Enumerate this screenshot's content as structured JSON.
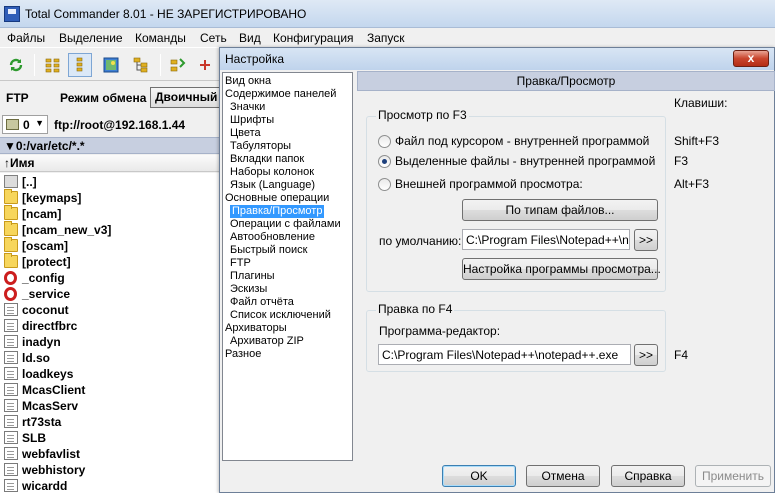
{
  "app": {
    "title": "Total Commander 8.01 - НЕ ЗАРЕГИСТРИРОВАНО"
  },
  "menu": [
    "Файлы",
    "Выделение",
    "Команды",
    "Сеть",
    "Вид",
    "Конфигурация",
    "Запуск"
  ],
  "toolbar": {
    "icons": [
      "refresh-icon",
      "brief-view-icon",
      "detailed-view-icon",
      "thumbnail-view-icon",
      "tree-view-icon",
      "invert-selection-icon"
    ]
  },
  "ftp_bar": {
    "label": "FTP",
    "mode_label": "Режим обмена",
    "mode_value": "Двоичный"
  },
  "drive_bar": {
    "drive": "0",
    "path": "ftp://root@192.168.1.44"
  },
  "panel": {
    "current_path": "▼0:/var/etc/*.*",
    "column_name": "↑Имя",
    "files": [
      {
        "name": "[..]",
        "type": "updir"
      },
      {
        "name": "[keymaps]",
        "type": "folder"
      },
      {
        "name": "[ncam]",
        "type": "folder"
      },
      {
        "name": "[ncam_new_v3]",
        "type": "folder"
      },
      {
        "name": "[oscam]",
        "type": "folder"
      },
      {
        "name": "[protect]",
        "type": "folder"
      },
      {
        "name": "_config",
        "type": "opera"
      },
      {
        "name": "_service",
        "type": "opera"
      },
      {
        "name": "coconut",
        "type": "file"
      },
      {
        "name": "directfbrc",
        "type": "file"
      },
      {
        "name": "inadyn",
        "type": "file"
      },
      {
        "name": "ld.so",
        "type": "file"
      },
      {
        "name": "loadkeys",
        "type": "file"
      },
      {
        "name": "McasClient",
        "type": "file"
      },
      {
        "name": "McasServ",
        "type": "file"
      },
      {
        "name": "rt73sta",
        "type": "file"
      },
      {
        "name": "SLB",
        "type": "file"
      },
      {
        "name": "webfavlist",
        "type": "file"
      },
      {
        "name": "webhistory",
        "type": "file"
      },
      {
        "name": "wicardd",
        "type": "file"
      }
    ]
  },
  "dialog": {
    "title": "Настройка",
    "close_label": "x",
    "tree": [
      {
        "label": "Вид окна",
        "level": 0
      },
      {
        "label": "Содержимое панелей",
        "level": 0
      },
      {
        "label": "Значки",
        "level": 1
      },
      {
        "label": "Шрифты",
        "level": 1
      },
      {
        "label": "Цвета",
        "level": 1
      },
      {
        "label": "Табуляторы",
        "level": 1
      },
      {
        "label": "Вкладки папок",
        "level": 1
      },
      {
        "label": "Наборы колонок",
        "level": 1
      },
      {
        "label": "Язык (Language)",
        "level": 1
      },
      {
        "label": "Основные операции",
        "level": 0
      },
      {
        "label": "Правка/Просмотр",
        "level": 1,
        "selected": true
      },
      {
        "label": "Операции с файлами",
        "level": 1
      },
      {
        "label": "Автообновление",
        "level": 1
      },
      {
        "label": "Быстрый поиск",
        "level": 1
      },
      {
        "label": "FTP",
        "level": 1
      },
      {
        "label": "Плагины",
        "level": 1
      },
      {
        "label": "Эскизы",
        "level": 1
      },
      {
        "label": "Файл отчёта",
        "level": 1
      },
      {
        "label": "Список исключений",
        "level": 1
      },
      {
        "label": "Архиваторы",
        "level": 0
      },
      {
        "label": "Архиватор ZIP",
        "level": 1
      },
      {
        "label": "Разное",
        "level": 0
      }
    ],
    "pane_title": "Правка/Просмотр",
    "keys_label": "Клавиши:",
    "view_group": {
      "title": "Просмотр по F3",
      "options": [
        {
          "label": "Файл под курсором - внутренней программой",
          "key": "Shift+F3",
          "checked": false
        },
        {
          "label": "Выделенные файлы - внутренней программой",
          "key": "F3",
          "checked": true
        },
        {
          "label": "Внешней программой просмотра:",
          "key": "Alt+F3",
          "checked": false
        }
      ],
      "by_file_types_button": "По типам файлов...",
      "default_label": "по умолчанию:",
      "default_path": "C:\\Program Files\\Notepad++\\notepad++.exe",
      "browse_button": ">>",
      "viewer_settings_button": "Настройка программы просмотра..."
    },
    "edit_group": {
      "title": "Правка по F4",
      "editor_label": "Программа-редактор:",
      "editor_path": "C:\\Program Files\\Notepad++\\notepad++.exe",
      "browse_button": ">>",
      "key": "F4"
    },
    "buttons": {
      "ok": "OK",
      "cancel": "Отмена",
      "help": "Справка",
      "apply": "Применить"
    }
  }
}
